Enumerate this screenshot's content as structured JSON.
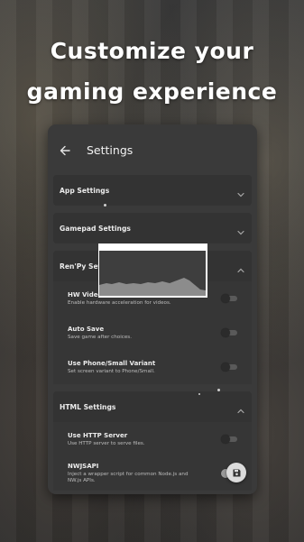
{
  "headline": {
    "line1": "Customize your",
    "line2": "gaming experience"
  },
  "app_bar": {
    "back_icon": "arrow-back-icon",
    "title": "Settings"
  },
  "sections": {
    "app": {
      "title": "App Settings",
      "icon": "chevron-down-icon"
    },
    "gamepad": {
      "title": "Gamepad Settings",
      "icon": "chevron-down-icon"
    },
    "renpy": {
      "title": "Ren'Py Settings",
      "icon": "chevron-up-icon",
      "rows": [
        {
          "title": "HW Video",
          "subtitle": "Enable hardware acceleration for videos.",
          "enabled": false
        },
        {
          "title": "Auto Save",
          "subtitle": "Save game after choices.",
          "enabled": false
        },
        {
          "title": "Use Phone/Small Variant",
          "subtitle": "Set screen variant to Phone/Small.",
          "enabled": false
        }
      ]
    },
    "html": {
      "title": "HTML Settings",
      "icon": "chevron-up-icon",
      "rows": [
        {
          "title": "Use HTTP Server",
          "subtitle": "Use HTTP server to serve files.",
          "enabled": false
        },
        {
          "title": "NWJSAPI",
          "subtitle": "Inject a wrapper script for common Node.js and NW.js APIs.",
          "enabled": false
        }
      ]
    }
  },
  "fab": {
    "icon": "save-icon"
  },
  "colors": {
    "background": "#2a2a2a",
    "panel": "#3a3a3a",
    "section": "#333333",
    "text": "#ececec",
    "subtext": "#bdbdbd"
  }
}
